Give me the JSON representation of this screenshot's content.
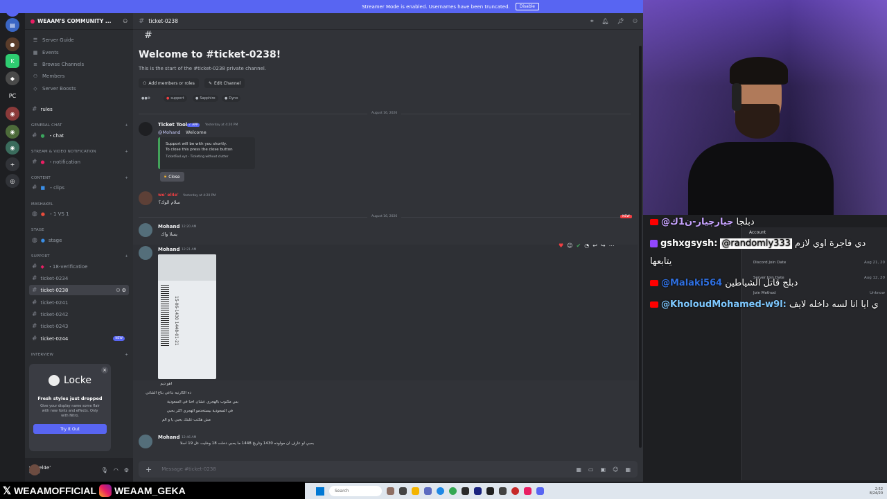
{
  "banner": {
    "text": "Streamer Mode is enabled. Usernames have been truncated.",
    "button": "Disable"
  },
  "server": {
    "name": "WEAAM'S COMMUNITY ...",
    "nav": [
      "Server Guide",
      "Events",
      "Browse Channels",
      "Members",
      "Server Boosts"
    ]
  },
  "channels": {
    "rules": "rules",
    "cat_general": "GENERAL CHAT",
    "chat": "・chat",
    "cat_stream": "STREAM & VIDEO NOTIFICATION",
    "notification": "・notification",
    "cat_content": "CONTENT",
    "clips": "・clips",
    "cat_mashakel": "MASHAKEL",
    "vs": "・1 VS 1",
    "cat_stage": "STAGE",
    "stage": "stage",
    "cat_support": "SUPPORT",
    "verification": "・18-verificatioe",
    "tickets": [
      "ticket-0234",
      "ticket-0238",
      "ticket-0241",
      "ticket-0242",
      "ticket-0243",
      "ticket-0244"
    ],
    "new_label": "NEW",
    "cat_interview": "INTERVIEW"
  },
  "nitro": {
    "brand": "Locke",
    "title": "Fresh styles just dropped",
    "desc": "Give your display name some flair with new fonts and effects. Only with Nitro.",
    "button": "Try It Out"
  },
  "user": {
    "name": "we' el4e'",
    "status": "Online"
  },
  "chat": {
    "channel": "ticket-0238",
    "welcome_title": "Welcome to #ticket-0238!",
    "welcome_sub": "This is the start of the #ticket-0238 private channel.",
    "add_members": "Add members or roles",
    "edit_channel": "Edit Channel",
    "tags": [
      "support",
      "Sapphire",
      "Dyno"
    ],
    "date1": "August 16, 2026",
    "date2": "August 16, 2026",
    "new_flag": "NEW",
    "bot_name": "Ticket Tool",
    "bot_badge": "✓ APP",
    "bot_time": "Yesterday at 4:20 PM",
    "bot_mention": "@Mohand",
    "bot_text": "Welcome",
    "embed_line1": "Support will be with you shortly.",
    "embed_line2": "To close this press the close button",
    "embed_footer": "TicketTool.xyz - Ticketing without clutter",
    "close": "Close",
    "m2_name": "we' el4e'",
    "m2_time": "Yesterday at 4:20 PM",
    "m2_text": "سلام الوك؟",
    "m3_name": "Mohand",
    "m3_time": "12:20 AM",
    "m3_text": "يسلا واك",
    "m4_name": "Mohand",
    "m4_time": "12:21 AM",
    "card_text": "15-06-1430 1448-01-21",
    "caption_lines": [
      "اهو ديم",
      "ده الكارنيه بتاعي بتاع الشاني",
      "بس مكتوب بالهجري عشان احنا في السعودية",
      "في السعودية بيستخدمو الهجري اكثر بحبي",
      "مش هكتب غلبتك بحبي يا و الم"
    ],
    "m5_name": "Mohand",
    "m5_time": "12:46 AM",
    "m5_text": "بحبي لو عارف ان مولوده 1430 وتاريخ 1448 ما يحبي دخلت 18 وخليت عل 19 اسلا",
    "composer_placeholder": "Message #ticket-0238"
  },
  "account": {
    "title": "Account",
    "rows": [
      [
        "Discord Join Date",
        "Aug 21, 20"
      ],
      [
        "Server Join Date",
        "Aug 12, 20"
      ],
      [
        "Join Method",
        "Unknow"
      ]
    ]
  },
  "stream_chat": [
    {
      "platform": "youtube",
      "user": "@جيارجيار-ن1ك",
      "text": "دبلجا"
    },
    {
      "platform": "twitch",
      "user": "gshxgsysh:",
      "mention": "@randomly333",
      "text": "دي فاجرة اوي لازم",
      "text2": "يتابعها"
    },
    {
      "platform": "youtube",
      "user": "@Malaki564",
      "text": "دبلج قاتل الشياطين"
    },
    {
      "platform": "youtube",
      "user": "@KholoudMohamed-w9l:",
      "text": "ي ايا انا لسه داخله لايف"
    }
  ],
  "social": {
    "x": "WEAAMOFFICIAL",
    "ig": "WEAAM_GEKA"
  },
  "taskbar": {
    "search": "Search",
    "time": "2:52",
    "date": "8/24/20"
  },
  "colors": {
    "blurple": "#5865f2",
    "green": "#43a25a",
    "red": "#f23f43"
  }
}
